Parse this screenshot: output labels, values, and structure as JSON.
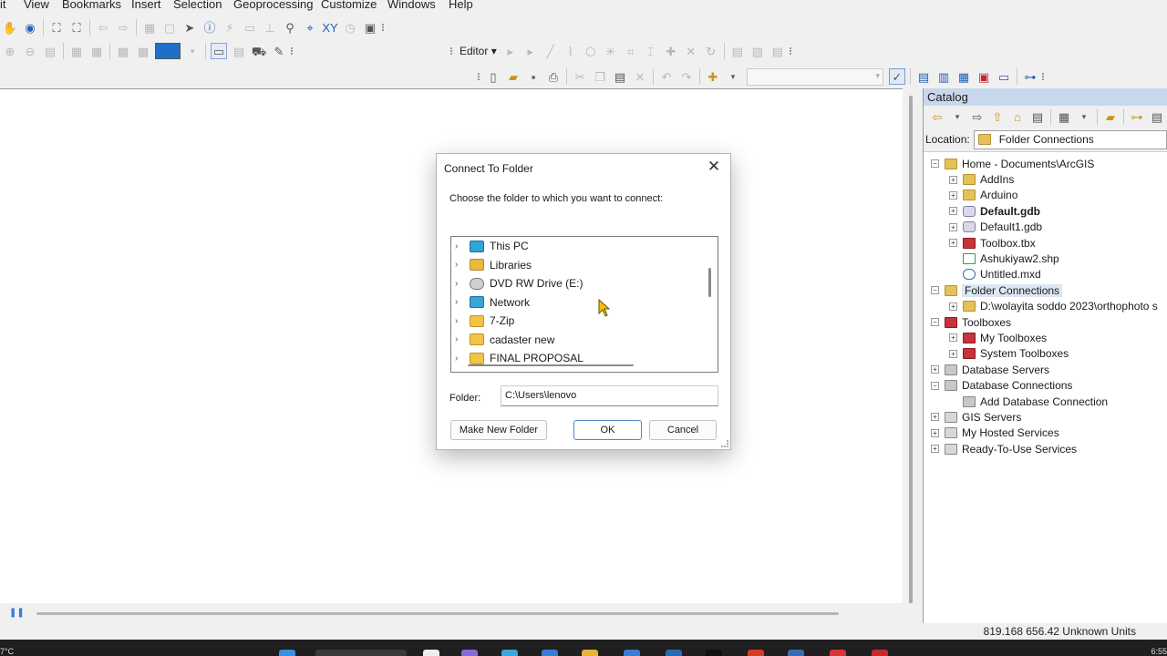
{
  "menu": [
    "it",
    "View",
    "Bookmarks",
    "Insert",
    "Selection",
    "Geoprocessing",
    "Customize",
    "Windows",
    "Help"
  ],
  "toolbar": {
    "editor_label": "Editor"
  },
  "dialog": {
    "title": "Connect To Folder",
    "close": "✕",
    "prompt": "Choose the folder to which you want to connect:",
    "items": [
      {
        "label": "This PC",
        "icon": "pc-icon"
      },
      {
        "label": "Libraries",
        "icon": "libraries-icon"
      },
      {
        "label": "DVD RW Drive (E:)",
        "icon": "dvd-drive-icon"
      },
      {
        "label": "Network",
        "icon": "network-icon"
      },
      {
        "label": "7-Zip",
        "icon": "folder-icon"
      },
      {
        "label": "cadaster new",
        "icon": "folder-icon"
      },
      {
        "label": "FINAL PROPOSAL",
        "icon": "folder-icon"
      }
    ],
    "folder_label": "Folder:",
    "folder_value": "C:\\Users\\lenovo",
    "make_new_folder": "Make New Folder",
    "ok": "OK",
    "cancel": "Cancel"
  },
  "catalog": {
    "title": "Catalog",
    "location_label": "Location:",
    "location_value": "Folder Connections",
    "tree": [
      {
        "label": "Home - Documents\\ArcGIS",
        "exp": "⊟",
        "icon": "home",
        "level": 0
      },
      {
        "label": "AddIns",
        "exp": "⊞",
        "icon": "folder",
        "level": 1
      },
      {
        "label": "Arduino",
        "exp": "⊞",
        "icon": "folder",
        "level": 1
      },
      {
        "label": "Default.gdb",
        "exp": "⊞",
        "icon": "gdb",
        "level": 1,
        "bold": true
      },
      {
        "label": "Default1.gdb",
        "exp": "⊞",
        "icon": "gdb",
        "level": 1
      },
      {
        "label": "Toolbox.tbx",
        "exp": "⊞",
        "icon": "tbx",
        "level": 1
      },
      {
        "label": "Ashukiyaw2.shp",
        "exp": "",
        "icon": "shp",
        "level": 1
      },
      {
        "label": "Untitled.mxd",
        "exp": "",
        "icon": "mxd",
        "level": 1
      },
      {
        "label": "Folder Connections",
        "exp": "⊟",
        "icon": "conn",
        "level": 0,
        "selected": true
      },
      {
        "label": "D:\\wolayita soddo 2023\\orthophoto s",
        "exp": "⊞",
        "icon": "folder",
        "level": 1
      },
      {
        "label": "Toolboxes",
        "exp": "⊟",
        "icon": "tbx",
        "level": 0
      },
      {
        "label": "My Toolboxes",
        "exp": "⊞",
        "icon": "tbx",
        "level": 1
      },
      {
        "label": "System Toolboxes",
        "exp": "⊞",
        "icon": "tbx",
        "level": 1
      },
      {
        "label": "Database Servers",
        "exp": "⊞",
        "icon": "db",
        "level": 0
      },
      {
        "label": "Database Connections",
        "exp": "⊟",
        "icon": "db",
        "level": 0
      },
      {
        "label": "Add Database Connection",
        "exp": "",
        "icon": "db",
        "level": 1
      },
      {
        "label": "GIS Servers",
        "exp": "⊞",
        "icon": "gis",
        "level": 0
      },
      {
        "label": "My Hosted Services",
        "exp": "⊞",
        "icon": "gis",
        "level": 0
      },
      {
        "label": "Ready-To-Use Services",
        "exp": "⊞",
        "icon": "gis",
        "level": 0
      }
    ]
  },
  "status": {
    "coords": "819.168  656.42 Unknown Units"
  },
  "taskbar": {
    "left_text": "7°C",
    "right_text": "6:55"
  }
}
